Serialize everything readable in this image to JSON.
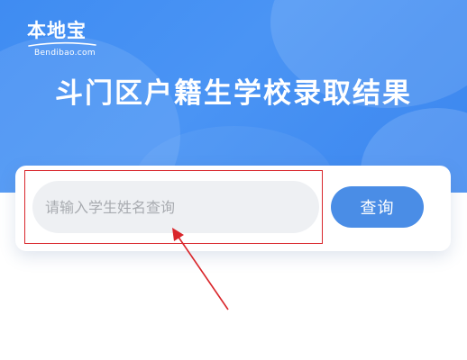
{
  "logo": {
    "name": "本地宝",
    "site": "Bendibao.com"
  },
  "page": {
    "title": "斗门区户籍生学校录取结果"
  },
  "search": {
    "placeholder": "请输入学生姓名查询",
    "value": "",
    "button_label": "查询"
  },
  "colors": {
    "hero_background": "#4190f3",
    "button_background": "#4a8de6",
    "input_background": "#eef0f3",
    "annotation_red": "#d9262b"
  },
  "icons": [
    "annotation-arrow-icon",
    "logo-swoosh-icon"
  ]
}
